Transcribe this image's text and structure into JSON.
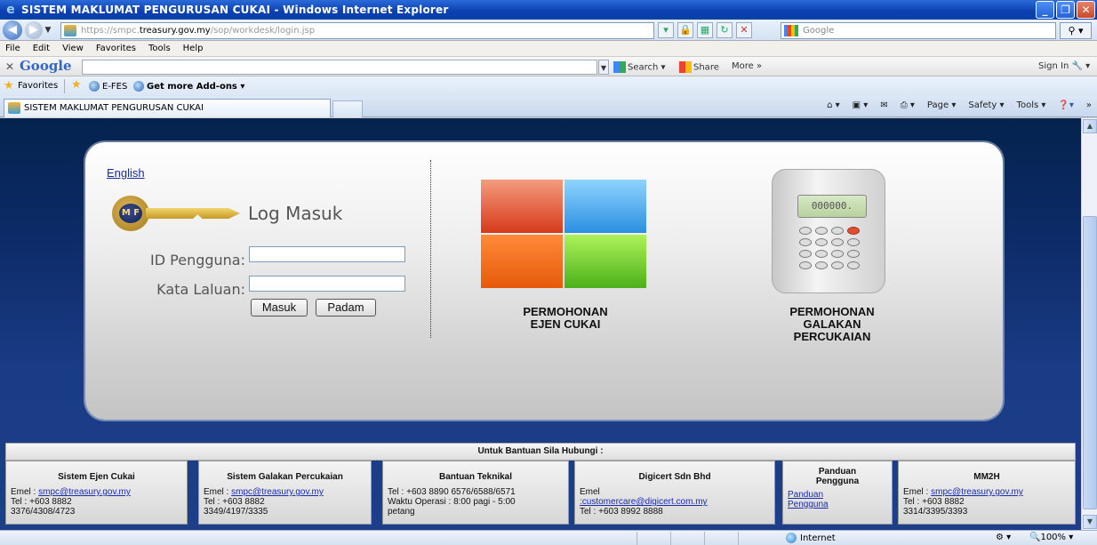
{
  "window": {
    "title": "SISTEM MAKLUMAT PENGURUSAN CUKAI - Windows Internet Explorer",
    "min_label": "_",
    "max_label": "❐",
    "close_label": "✕"
  },
  "address": {
    "url_prefix": "https://smpc.",
    "url_host": "treasury.gov.my",
    "url_path": "/sop/workdesk/login.jsp",
    "search_placeholder": "Google"
  },
  "menu": [
    "File",
    "Edit",
    "View",
    "Favorites",
    "Tools",
    "Help"
  ],
  "google_toolbar": {
    "logo": "Google",
    "search_label": "Search",
    "share_label": "Share",
    "more_label": "More »",
    "signin_label": "Sign In"
  },
  "favorites": {
    "label": "Favorites",
    "items": [
      "E-FES",
      "Get more Add-ons"
    ]
  },
  "tab": {
    "title": "SISTEM MAKLUMAT PENGURUSAN CUKAI"
  },
  "command_bar": [
    "Page",
    "Safety",
    "Tools"
  ],
  "login": {
    "language_link": "English",
    "key_badge": "M F",
    "heading": "Log Masuk",
    "user_label": "ID Pengguna:",
    "user_value": "",
    "pass_label": "Kata Laluan:",
    "pass_value": "",
    "submit_label": "Masuk",
    "reset_label": "Padam"
  },
  "tiles": {
    "agent_line1": "PERMOHONAN",
    "agent_line2": "EJEN CUKAI",
    "incentive_line1": "PERMOHONAN",
    "incentive_line2": "GALAKAN",
    "incentive_line3": "PERCUKAIAN",
    "calc_display": "000000."
  },
  "footer": {
    "heading": "Untuk Bantuan Sila Hubungi :",
    "boxes": [
      {
        "title": "Sistem Ejen Cukai",
        "emel_label": "Emel  :",
        "emel": "smpc@treasury.gov.my",
        "tel_label": "Tel    : +603 8882",
        "tel2": "3376/4308/4723"
      },
      {
        "title": "Sistem Galakan Percukaian",
        "emel_label": "Emel  :",
        "emel": "smpc@treasury.gov.my",
        "tel_label": "Tel    : +603 8882",
        "tel2": "3349/4197/3335"
      },
      {
        "title": "Bantuan Teknikal",
        "line1": "Tel  : +603 8890 6576/6588/6571",
        "line2": "Waktu Operasi  : 8:00 pagi - 5:00",
        "line3": "petang"
      },
      {
        "title": "Digicert Sdn Bhd",
        "emel_label": "Emel",
        "emel": ":customercare@digicert.com.my",
        "tel_label": "Tel    : +603 8992 8888"
      },
      {
        "title": "Panduan Pengguna",
        "link": "Panduan Pengguna"
      },
      {
        "title": "MM2H",
        "emel_label": "Emel  :",
        "emel": "smpc@treasury.gov.my",
        "tel_label": "Tel    : +603 8882",
        "tel2": "3314/3395/3393"
      }
    ]
  },
  "status": {
    "zone": "Internet",
    "zoom": "100%"
  }
}
